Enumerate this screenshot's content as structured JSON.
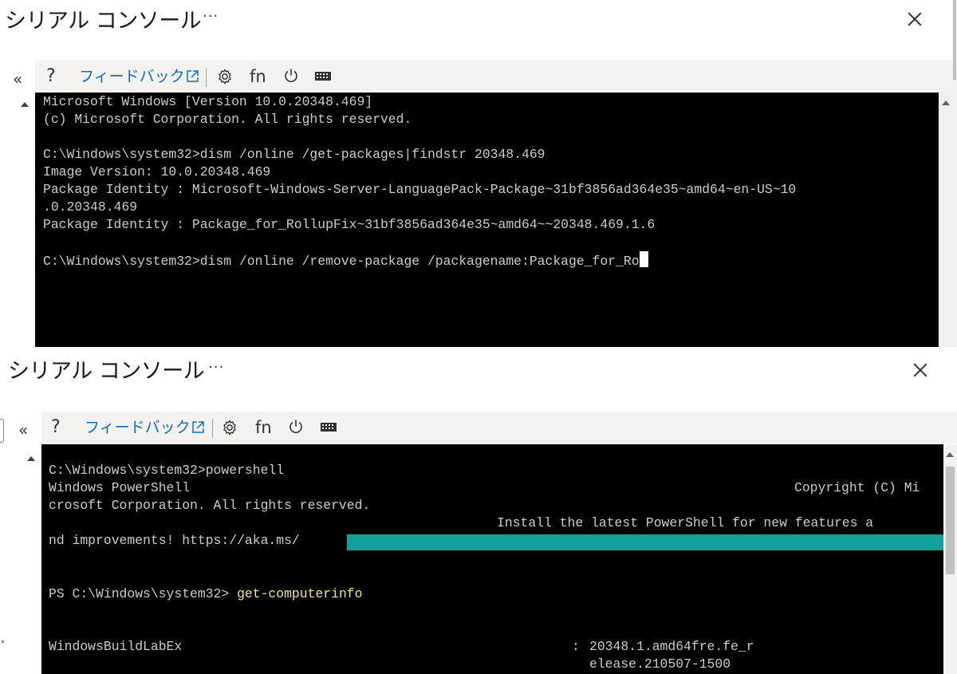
{
  "top": {
    "title": "シリアル コンソール",
    "more": "···",
    "collapse": "«",
    "toolbar": {
      "help": "?",
      "feedback": "フィードバック",
      "fn": "fn"
    },
    "terminal": {
      "lines": [
        "Microsoft Windows [Version 10.0.20348.469]",
        "(c) Microsoft Corporation. All rights reserved.",
        "",
        "C:\\Windows\\system32>dism /online /get-packages|findstr 20348.469",
        "Image Version: 10.0.20348.469",
        "Package Identity : Microsoft-Windows-Server-LanguagePack-Package~31bf3856ad364e35~amd64~en-US~10",
        ".0.20348.469",
        "Package Identity : Package_for_RollupFix~31bf3856ad364e35~amd64~~20348.469.1.6",
        "",
        "C:\\Windows\\system32>dism /online /remove-package /packagename:Package_for_Ro"
      ]
    }
  },
  "bottom": {
    "title": "シリアル コンソール",
    "more": "···",
    "collapse": "«",
    "toolbar": {
      "help": "?",
      "feedback": "フィードバック",
      "fn": "fn"
    },
    "terminal": {
      "l1": "C:\\Windows\\system32>powershell",
      "l2a": "Windows PowerShell",
      "l2b": "Copyright (C) Mi",
      "l3": "crosoft Corporation. All rights reserved.",
      "l4": "Install the latest PowerShell for new features a",
      "l5": "nd improvements! https://aka.ms/",
      "prompt": "PS C:\\Windows\\system32> ",
      "command": "get-computerinfo",
      "prop_name": "WindowsBuildLabEx",
      "prop_sep": ":",
      "prop_val1": "20348.1.amd64fre.fe_r",
      "prop_val2": "elease.210507-1500"
    },
    "colors": {
      "highlight": "#13a09a",
      "command": "#f0e68c"
    }
  }
}
